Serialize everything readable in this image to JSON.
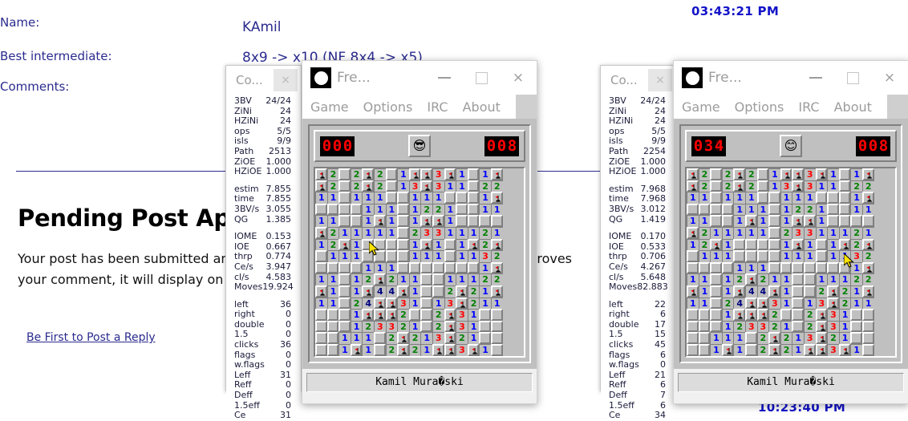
{
  "page": {
    "labels": {
      "name": "Name:",
      "best": "Best intermediate:",
      "comments": "Comments:"
    },
    "values": {
      "name": "KAmil",
      "best": "8x9 -> x10 (NF 8x4 -> x5)"
    },
    "clock_top": "03:43:21 PM",
    "clock_bottom": "10:23:40 PM",
    "pending_title": "Pending Post App",
    "pending_line1": "Your post has been submitted and is awaiting approval. Once the moderator approves",
    "pending_line2": "your comment, it will display on the page.",
    "reply_link": "Be First to Post a Reply"
  },
  "stats_left": {
    "title": "Co...",
    "close_label": "×",
    "group1": [
      {
        "k": "3BV",
        "v": "24/24"
      },
      {
        "k": "ZiNi",
        "v": "24"
      },
      {
        "k": "HZiNi",
        "v": "24"
      },
      {
        "k": "ops",
        "v": "5/5"
      },
      {
        "k": "isls",
        "v": "9/9"
      },
      {
        "k": "Path",
        "v": "2513"
      },
      {
        "k": "ZiOE",
        "v": "1.000"
      },
      {
        "k": "HZiOE",
        "v": "1.000"
      }
    ],
    "group2": [
      {
        "k": "estim",
        "v": "7.855"
      },
      {
        "k": "time",
        "v": "7.855"
      },
      {
        "k": "3BV/s",
        "v": "3.055"
      },
      {
        "k": "QG",
        "v": "1.385"
      }
    ],
    "group3": [
      {
        "k": "IOME",
        "v": "0.153"
      },
      {
        "k": "IOE",
        "v": "0.667"
      },
      {
        "k": "thrp",
        "v": "0.774"
      },
      {
        "k": "Ce/s",
        "v": "3.947"
      },
      {
        "k": "cl/s",
        "v": "4.583"
      },
      {
        "k": "Moves",
        "v": "19.924"
      }
    ],
    "group4": [
      {
        "k": "left",
        "v": "36"
      },
      {
        "k": "right",
        "v": "0"
      },
      {
        "k": "double",
        "v": "0"
      },
      {
        "k": "1.5",
        "v": "0"
      },
      {
        "k": "clicks",
        "v": "36"
      },
      {
        "k": "flags",
        "v": "0"
      },
      {
        "k": "w.flags",
        "v": "0"
      },
      {
        "k": "Leff",
        "v": "31"
      },
      {
        "k": "Reff",
        "v": "0"
      },
      {
        "k": "Deff",
        "v": "0"
      },
      {
        "k": "1.5eff",
        "v": "0"
      },
      {
        "k": "Ce",
        "v": "31"
      }
    ]
  },
  "stats_right": {
    "title": "Co...",
    "close_label": "×",
    "group1": [
      {
        "k": "3BV",
        "v": "24/24"
      },
      {
        "k": "ZiNi",
        "v": "24"
      },
      {
        "k": "HZiNi",
        "v": "24"
      },
      {
        "k": "ops",
        "v": "5/5"
      },
      {
        "k": "isls",
        "v": "9/9"
      },
      {
        "k": "Path",
        "v": "2254"
      },
      {
        "k": "ZiOE",
        "v": "1.000"
      },
      {
        "k": "HZiOE",
        "v": "1.000"
      }
    ],
    "group2": [
      {
        "k": "estim",
        "v": "7.968"
      },
      {
        "k": "time",
        "v": "7.968"
      },
      {
        "k": "3BV/s",
        "v": "3.012"
      },
      {
        "k": "QG",
        "v": "1.419"
      }
    ],
    "group3": [
      {
        "k": "IOME",
        "v": "0.170"
      },
      {
        "k": "IOE",
        "v": "0.533"
      },
      {
        "k": "thrp",
        "v": "0.706"
      },
      {
        "k": "Ce/s",
        "v": "4.267"
      },
      {
        "k": "cl/s",
        "v": "5.648"
      },
      {
        "k": "Moves",
        "v": "82.883"
      }
    ],
    "group4": [
      {
        "k": "left",
        "v": "22"
      },
      {
        "k": "right",
        "v": "6"
      },
      {
        "k": "double",
        "v": "17"
      },
      {
        "k": "1.5",
        "v": "15"
      },
      {
        "k": "clicks",
        "v": "45"
      },
      {
        "k": "flags",
        "v": "6"
      },
      {
        "k": "w.flags",
        "v": "0"
      },
      {
        "k": "Leff",
        "v": "21"
      },
      {
        "k": "Reff",
        "v": "6"
      },
      {
        "k": "Deff",
        "v": "7"
      },
      {
        "k": "1.5eff",
        "v": "6"
      },
      {
        "k": "Ce",
        "v": "34"
      }
    ]
  },
  "minesweeper_left": {
    "app_title": "Fre...",
    "menus": [
      "Game",
      "Options",
      "IRC",
      "About"
    ],
    "mine_counter": "000",
    "timer": "008",
    "face": "😎",
    "status_text": "Kamil Mura�ski",
    "window_buttons": {
      "minimize": "minimize-button",
      "maximize": "maximize-button",
      "close": "×"
    },
    "grid": {
      "cols": 16,
      "rows": 16,
      "cells": [
        "F",
        "2",
        "",
        "2",
        "F",
        "2",
        "",
        "1",
        "F",
        "F",
        "3",
        "F",
        "1",
        "",
        "1",
        "F",
        "F",
        "2",
        "",
        "2",
        "F",
        "2",
        "",
        "1",
        "3",
        "F",
        "3",
        "1",
        "1",
        "",
        "2",
        "2",
        "1",
        "1",
        "",
        "1",
        "1",
        "1",
        "",
        "",
        "1",
        "1",
        "1",
        "",
        "",
        "",
        "1",
        "F",
        "",
        "",
        "",
        "",
        "1",
        "1",
        "1",
        "",
        "1",
        "2",
        "2",
        "1",
        "",
        "",
        "1",
        "1",
        "1",
        "1",
        "",
        "",
        "1",
        "F",
        "1",
        "",
        "1",
        "F",
        "F",
        "1",
        "",
        "",
        "",
        "",
        "F",
        "2",
        "1",
        "1",
        "1",
        "1",
        "1",
        "",
        "2",
        "3",
        "3",
        "1",
        "1",
        "1",
        "2",
        "1",
        "1",
        "2",
        "F",
        "1",
        "",
        "",
        "",
        "",
        "1",
        "F",
        "1",
        "",
        "1",
        "F",
        "2",
        "F",
        "",
        "1",
        "1",
        "1",
        "",
        "",
        "",
        "",
        "1",
        "1",
        "1",
        "",
        "1",
        "1",
        "3",
        "2",
        "",
        "",
        "",
        "",
        "1",
        "1",
        "1",
        "",
        "",
        "",
        "",
        "",
        "",
        "",
        "1",
        "F",
        "1",
        "1",
        "",
        "1",
        "2",
        "F",
        "2",
        "1",
        "1",
        "",
        "",
        "1",
        "1",
        "1",
        "2",
        "2",
        "F",
        "1",
        "",
        "1",
        "F",
        "4",
        "4",
        "F",
        "1",
        "",
        "",
        "2",
        "F",
        "2",
        "1",
        "F",
        "1",
        "1",
        "",
        "2",
        "4",
        "F",
        "F",
        "3",
        "1",
        "",
        "1",
        "3",
        "F",
        "2",
        "1",
        "1",
        "",
        "",
        "",
        "1",
        "F",
        "F",
        "F",
        "2",
        "",
        "",
        "2",
        "F",
        "3",
        "1",
        "",
        "",
        "",
        "",
        "",
        "1",
        "2",
        "3",
        "3",
        "2",
        "1",
        "",
        "2",
        "F",
        "3",
        "1",
        "",
        "",
        "",
        "",
        "1",
        "1",
        "1",
        "",
        "2",
        "F",
        "2",
        "1",
        "3",
        "F",
        "2",
        "1",
        "",
        "",
        "",
        "",
        "1",
        "F",
        "1",
        "",
        "2",
        "F",
        "2",
        "1",
        "F",
        "F",
        "3",
        "F",
        "1",
        ""
      ]
    }
  },
  "minesweeper_right": {
    "app_title": "Fre...",
    "menus": [
      "Game",
      "Options",
      "IRC",
      "About"
    ],
    "mine_counter": "034",
    "timer": "008",
    "face": "😊",
    "status_text": "Kamil Mura�ski",
    "window_buttons": {
      "minimize": "minimize-button",
      "maximize": "maximize-button",
      "close": "×"
    },
    "grid": {
      "cols": 16,
      "rows": 16,
      "cells": [
        "F",
        "2",
        "",
        "2",
        "F",
        "2",
        "",
        "1",
        "F",
        "F",
        "3",
        "F",
        "1",
        "",
        "1",
        "F",
        "F",
        "2",
        "",
        "2",
        "F",
        "2",
        "",
        "1",
        "3",
        "F",
        "3",
        "1",
        "1",
        "",
        "2",
        "2",
        "1",
        "1",
        "",
        "1",
        "1",
        "1",
        "",
        "",
        "1",
        "1",
        "1",
        "",
        "",
        "",
        "1",
        "F",
        "",
        "",
        "",
        "",
        "1",
        "1",
        "1",
        "",
        "1",
        "2",
        "2",
        "1",
        "",
        "",
        "1",
        "1",
        "1",
        "1",
        "",
        "",
        "1",
        "F",
        "1",
        "",
        "1",
        "F",
        "F",
        "1",
        "",
        "",
        "",
        "",
        "F",
        "2",
        "1",
        "1",
        "1",
        "1",
        "1",
        "",
        "2",
        "3",
        "3",
        "1",
        "1",
        "1",
        "2",
        "1",
        "1",
        "2",
        "F",
        "1",
        "",
        "",
        "",
        "",
        "1",
        "F",
        "1",
        "",
        "1",
        "F",
        "2",
        "F",
        "",
        "1",
        "1",
        "1",
        "",
        "",
        "",
        "",
        "1",
        "1",
        "1",
        "",
        "1",
        "1",
        "3",
        "2",
        "",
        "",
        "",
        "",
        "1",
        "1",
        "1",
        "",
        "",
        "",
        "",
        "",
        "",
        "",
        "1",
        "F",
        "1",
        "1",
        "",
        "1",
        "2",
        "F",
        "2",
        "1",
        "1",
        "",
        "",
        "1",
        "1",
        "1",
        "2",
        "2",
        "F",
        "1",
        "",
        "1",
        "F",
        "4",
        "4",
        "F",
        "1",
        "",
        "",
        "2",
        "F",
        "2",
        "1",
        "F",
        "1",
        "1",
        "",
        "2",
        "4",
        "F",
        "F",
        "3",
        "1",
        "",
        "1",
        "3",
        "F",
        "2",
        "1",
        "1",
        "",
        "",
        "",
        "1",
        "F",
        "F",
        "F",
        "2",
        "",
        "",
        "2",
        "F",
        "3",
        "1",
        "",
        "",
        "",
        "",
        "",
        "1",
        "2",
        "3",
        "3",
        "2",
        "1",
        "",
        "2",
        "F",
        "3",
        "1",
        "",
        "",
        "",
        "",
        "1",
        "1",
        "1",
        "",
        "2",
        "F",
        "2",
        "1",
        "3",
        "F",
        "2",
        "1",
        "",
        "",
        "",
        "",
        "1",
        "F",
        "1",
        "",
        "2",
        "F",
        "2",
        "1",
        "F",
        "F",
        "3",
        "F",
        "1",
        ""
      ]
    }
  },
  "colors": {
    "link": "#2b2b8f",
    "clock": "#1313c9",
    "lcd_red": "#ff0000",
    "chrome": "#c0c0c0"
  }
}
